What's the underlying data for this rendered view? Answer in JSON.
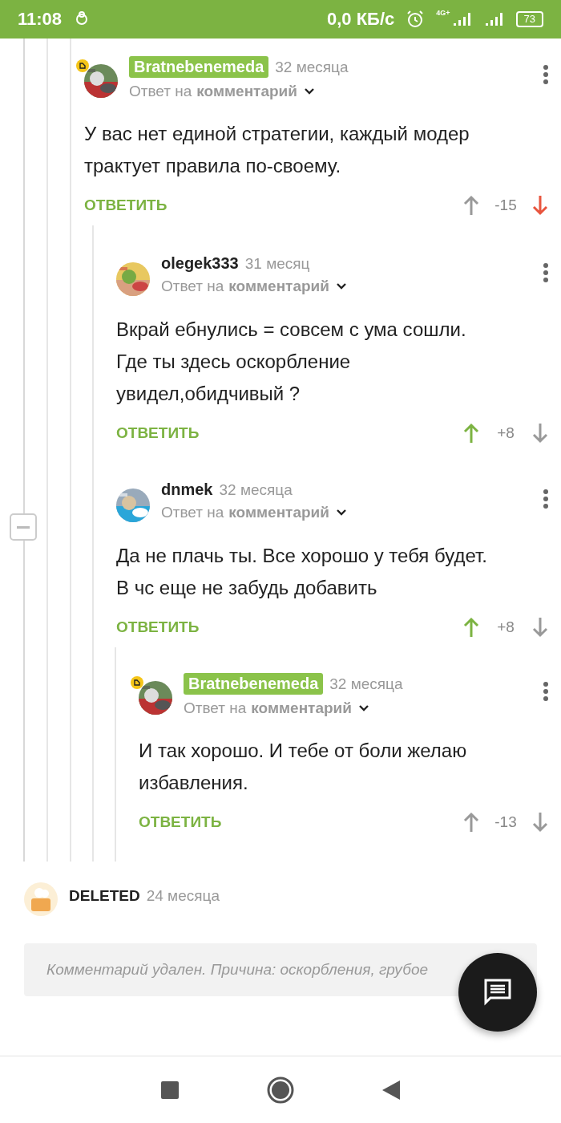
{
  "status_bar": {
    "time": "11:08",
    "speed": "0,0 КБ/с",
    "network": "4G+",
    "battery": "73"
  },
  "thread": {
    "collapse_button": {
      "expanded": true
    },
    "comments": [
      {
        "author": "Bratnebenemeda",
        "highlighted": true,
        "badge": true,
        "time": "32 месяца",
        "reply_prefix": "Ответ на",
        "reply_target": "комментарий",
        "text": "У вас нет единой стратегии, каждый модер трактует правила по-своему.",
        "reply": "ОТВЕТИТЬ",
        "score": "-15",
        "upvoted": false,
        "downvoted": true,
        "children": [
          {
            "author": "olegek333",
            "highlighted": false,
            "badge": false,
            "time": "31 месяц",
            "reply_prefix": "Ответ на",
            "reply_target": "комментарий",
            "text": "Вкрай ебнулись = совсем с ума сошли. Где ты здесь оскорбление увидел,обидчивый ?",
            "reply": "ОТВЕТИТЬ",
            "score": "+8",
            "upvoted": true,
            "downvoted": false
          },
          {
            "author": "dnmek",
            "highlighted": false,
            "badge": false,
            "time": "32 месяца",
            "reply_prefix": "Ответ на",
            "reply_target": "комментарий",
            "text": "Да не плачь ты. Все хорошо у тебя будет. В чс еще не забудь добавить",
            "reply": "ОТВЕТИТЬ",
            "score": "+8",
            "upvoted": true,
            "downvoted": false,
            "children": [
              {
                "author": "Bratnebenemeda",
                "highlighted": true,
                "badge": true,
                "time": "32 месяца",
                "reply_prefix": "Ответ на",
                "reply_target": "комментарий",
                "text": "И так хорошо. И тебе от боли желаю избавления.",
                "reply": "ОТВЕТИТЬ",
                "score": "-13",
                "upvoted": false,
                "downvoted": false
              }
            ]
          }
        ]
      }
    ]
  },
  "deleted_comment": {
    "author": "DELETED",
    "time": "24 месяца",
    "text": "Комментарий удален. Причина: оскорбления, грубое"
  }
}
